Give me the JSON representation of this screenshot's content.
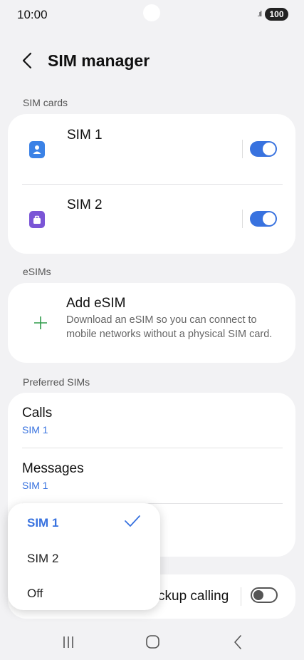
{
  "status": {
    "time": "10:00",
    "signal": ".ıl",
    "battery": "100"
  },
  "header": {
    "title": "SIM manager"
  },
  "sections": {
    "sim_cards": "SIM cards",
    "esims": "eSIMs",
    "preferred": "Preferred SIMs"
  },
  "sim_cards": [
    {
      "label": "SIM 1",
      "enabled": true,
      "color": "#3b82e6"
    },
    {
      "label": "SIM 2",
      "enabled": true,
      "color": "#7a55d6"
    }
  ],
  "esim": {
    "title": "Add eSIM",
    "description": "Download an eSIM so you can connect to mobile networks without a physical SIM card."
  },
  "preferred": {
    "calls": {
      "title": "Calls",
      "value": "SIM 1"
    },
    "messages": {
      "title": "Messages",
      "value": "SIM 1"
    }
  },
  "backup_calling": {
    "label_visible": "ckup calling",
    "enabled": false
  },
  "dropdown": {
    "options": [
      "SIM 1",
      "SIM 2",
      "Off"
    ],
    "selected": "SIM 1"
  },
  "colors": {
    "accent": "#3872df",
    "add_icon": "#2e9b4a"
  }
}
